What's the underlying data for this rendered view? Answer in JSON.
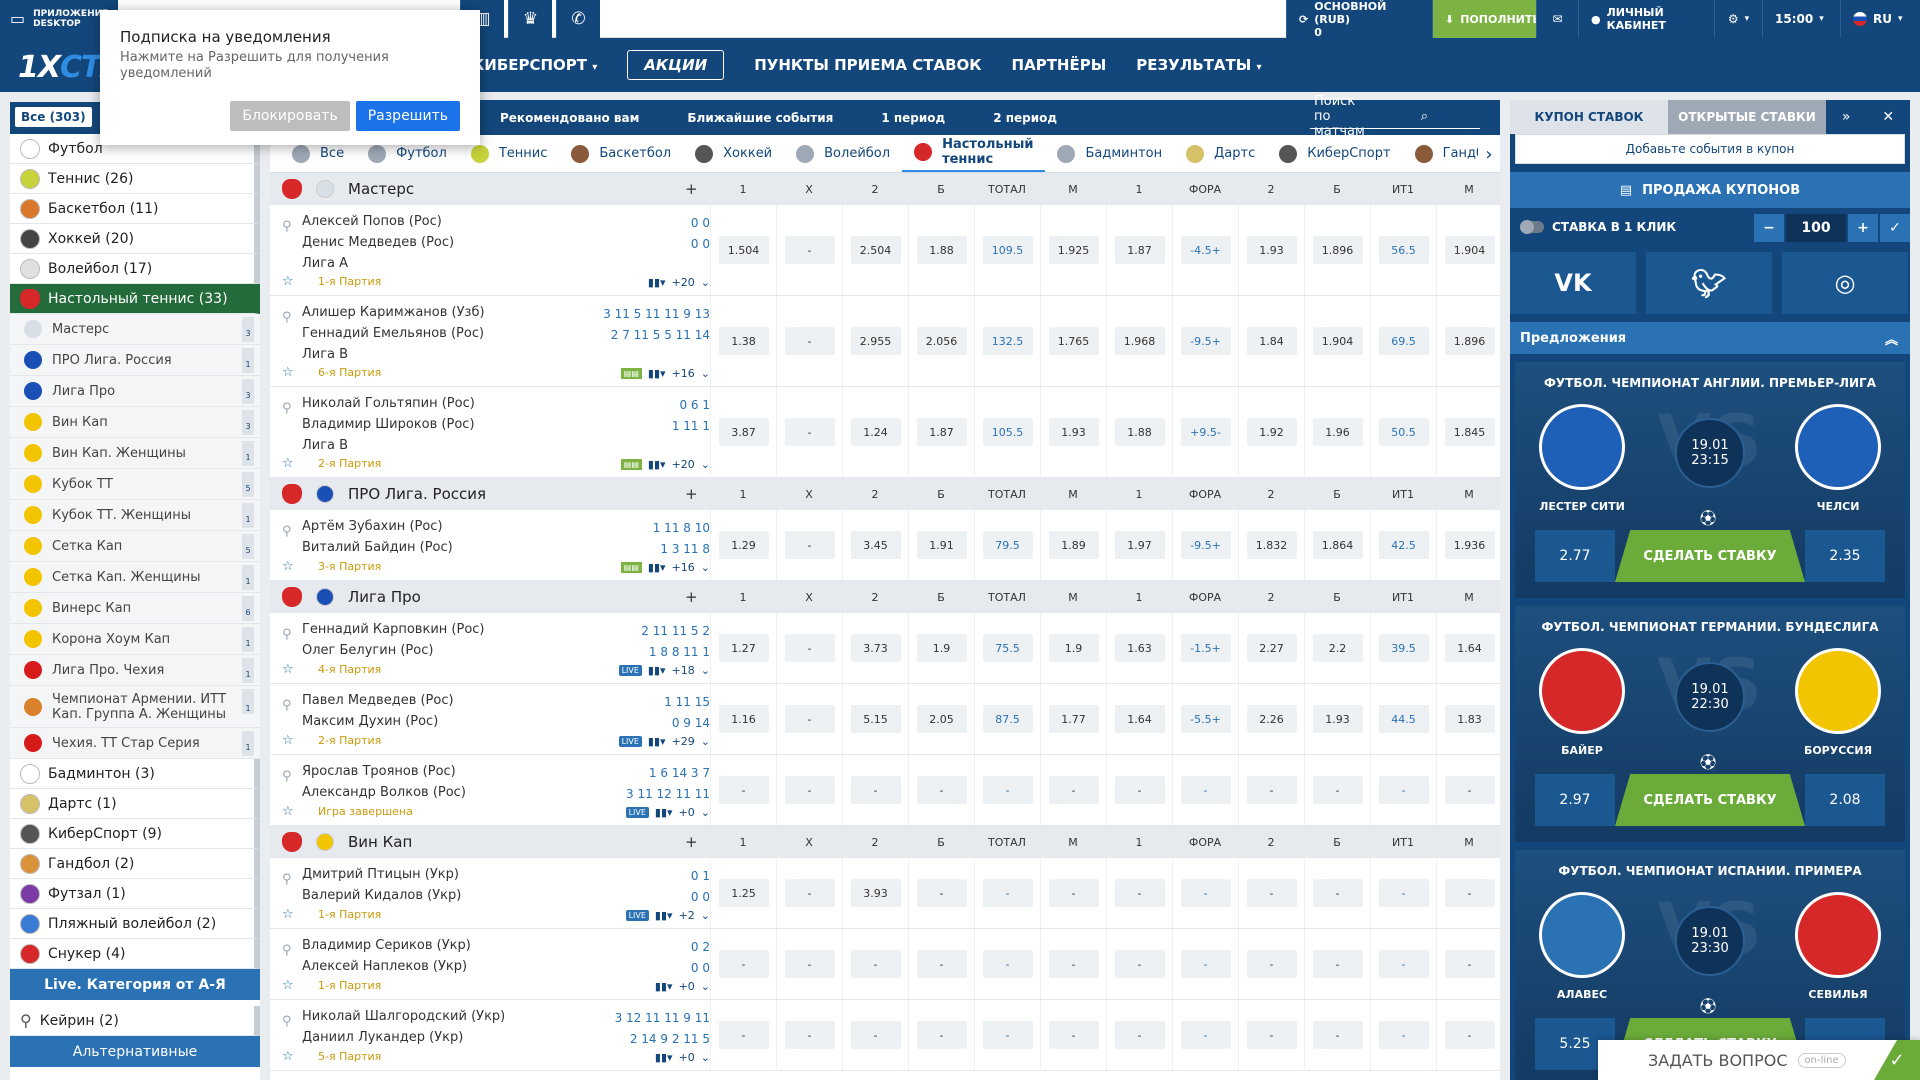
{
  "topbar": {
    "app_label": "ПРИЛОЖЕНИЕ DESKTOP",
    "balance_title": "ОСНОВНОЙ (RUB)",
    "balance_value": "0",
    "deposit": "ПОПОЛНИТЬ",
    "cabinet": "ЛИЧНЫЙ КАБИНЕТ",
    "time": "15:00",
    "lang": "RU"
  },
  "logo": {
    "a": "1X",
    "b": "СТАВКА"
  },
  "nav": {
    "items": [
      "КИБЕРСПОРТ",
      "АКЦИИ",
      "ПУНКТЫ ПРИЕМА СТАВОК",
      "ПАРТНЁРЫ",
      "РЕЗУЛЬТАТЫ"
    ]
  },
  "notification": {
    "title": "Подписка на уведомления",
    "text": "Нажмите на Разрешить для получения уведомлений",
    "block": "Блокировать",
    "allow": "Разрешить"
  },
  "sidebar": {
    "all": "Все (303)",
    "sports_top": [
      {
        "label": "Футбол",
        "color": "#ffffff"
      },
      {
        "label": "Теннис (26)",
        "color": "#c8d23a"
      },
      {
        "label": "Баскетбол (11)",
        "color": "#d9772b"
      },
      {
        "label": "Хоккей (20)",
        "color": "#444444"
      },
      {
        "label": "Волейбол (17)",
        "color": "#e0e0e0"
      }
    ],
    "active_sport": "Настольный теннис (33)",
    "champs": [
      {
        "label": "Мастерс",
        "count": "3",
        "flag": "#d9dfe6"
      },
      {
        "label": "ПРО Лига. Россия",
        "count": "1",
        "flag": "#1a4fb5"
      },
      {
        "label": "Лига Про",
        "count": "3",
        "flag": "#1a4fb5"
      },
      {
        "label": "Вин Кап",
        "count": "3",
        "flag": "#f2c500"
      },
      {
        "label": "Вин Кап. Женщины",
        "count": "1",
        "flag": "#f2c500"
      },
      {
        "label": "Кубок ТТ",
        "count": "5",
        "flag": "#f2c500"
      },
      {
        "label": "Кубок ТТ. Женщины",
        "count": "1",
        "flag": "#f2c500"
      },
      {
        "label": "Сетка Кап",
        "count": "5",
        "flag": "#f2c500"
      },
      {
        "label": "Сетка Кап. Женщины",
        "count": "1",
        "flag": "#f2c500"
      },
      {
        "label": "Винерс Кап",
        "count": "6",
        "flag": "#f2c500"
      },
      {
        "label": "Корона Хоум Кап",
        "count": "1",
        "flag": "#f2c500"
      },
      {
        "label": "Лига Про. Чехия",
        "count": "1",
        "flag": "#d71a1a"
      }
    ],
    "champ_two": {
      "line1": "Чемпионат Армении. ИТТ",
      "line2": "Кап. Группа А. Женщины",
      "count": "1",
      "flag": "#d9822b"
    },
    "champ_last": {
      "label": "Чехия. ТТ Стар Серия",
      "count": "1",
      "flag": "#d71a1a"
    },
    "sports_bottom": [
      {
        "label": "Бадминтон (3)",
        "color": "#ffffff"
      },
      {
        "label": "Дартс (1)",
        "color": "#d6c068"
      },
      {
        "label": "КиберСпорт (9)",
        "color": "#555555"
      },
      {
        "label": "Гандбол (2)",
        "color": "#d9913a"
      },
      {
        "label": "Футзал (1)",
        "color": "#7b3aa6"
      },
      {
        "label": "Пляжный волейбол (2)",
        "color": "#3a7bd6"
      },
      {
        "label": "Снукер (4)",
        "color": "#d62828"
      }
    ],
    "live_cat": "Live. Категория от А-Я",
    "keirin": "Кейрин (2)",
    "alt": "Альтернативные"
  },
  "main": {
    "subtabs": [
      "Рекомендовано вам",
      "Ближайшие события",
      "1 период",
      "2 период"
    ],
    "search": "Поиск по матчам",
    "sporttabs": [
      {
        "label": "Все",
        "color": "#9ea9b5"
      },
      {
        "label": "Футбол",
        "color": "#9ea9b5"
      },
      {
        "label": "Теннис",
        "color": "#c8d23a"
      },
      {
        "label": "Баскетбол",
        "color": "#8a5a3a"
      },
      {
        "label": "Хоккей",
        "color": "#555555"
      },
      {
        "label": "Волейбол",
        "color": "#9ea9b5"
      },
      {
        "label": "Настольный теннис",
        "color": "#d62828"
      },
      {
        "label": "Бадминтон",
        "color": "#9ea9b5"
      },
      {
        "label": "Дартс",
        "color": "#d6c068"
      },
      {
        "label": "КиберСпорт",
        "color": "#555555"
      },
      {
        "label": "Гандбол",
        "color": "#8a5a3a"
      }
    ],
    "headers": [
      "1",
      "X",
      "2",
      "Б",
      "ТОТАЛ",
      "М",
      "1",
      "ФОРА",
      "2",
      "Б",
      "ИТ1",
      "М"
    ],
    "groups": [
      {
        "name": "Мастерс",
        "flag": "#d9dfe6",
        "matches": [
          {
            "p1": "Алексей Попов (Рос)",
            "p2": "Денис Медведев (Рос)",
            "league": "Лига А",
            "s1": "0   0",
            "s2": "0   0",
            "period": "1-я Партия",
            "more": "+20",
            "badge": "",
            "tall": true,
            "odds": [
              "1.504",
              "-",
              "2.504",
              "1.88",
              "109.5",
              "1.925",
              "1.87",
              "-4.5+",
              "1.93",
              "1.896",
              "56.5",
              "1.904"
            ]
          },
          {
            "p1": "Алишер Каримжанов (Узб)",
            "p2": "Геннадий Емельянов (Рос)",
            "league": "Лига В",
            "s1": "3  11  5  11  11  9  13",
            "s2": "2  7  11  5  5  11  14",
            "period": "6-я Партия",
            "more": "+16",
            "badge": "stat",
            "tall": true,
            "odds": [
              "1.38",
              "-",
              "2.955",
              "2.056",
              "132.5",
              "1.765",
              "1.968",
              "-9.5+",
              "1.84",
              "1.904",
              "69.5",
              "1.896"
            ]
          },
          {
            "p1": "Николай Гольтяпин (Рос)",
            "p2": "Владимир Широков (Рос)",
            "league": "Лига В",
            "s1": "0   6   1",
            "s2": "1  11   1",
            "period": "2-я Партия",
            "more": "+20",
            "badge": "stat",
            "tall": true,
            "odds": [
              "3.87",
              "-",
              "1.24",
              "1.87",
              "105.5",
              "1.93",
              "1.88",
              "+9.5-",
              "1.92",
              "1.96",
              "50.5",
              "1.845"
            ]
          }
        ]
      },
      {
        "name": "ПРО Лига. Россия",
        "flag": "#1a4fb5",
        "matches": [
          {
            "p1": "Артём Зубахин (Рос)",
            "p2": "Виталий Байдин (Рос)",
            "league": "",
            "s1": "1  11  8  10",
            "s2": "1   3  11  8",
            "period": "3-я Партия",
            "more": "+16",
            "badge": "stat",
            "tall": false,
            "odds": [
              "1.29",
              "-",
              "3.45",
              "1.91",
              "79.5",
              "1.89",
              "1.97",
              "-9.5+",
              "1.832",
              "1.864",
              "42.5",
              "1.936"
            ]
          }
        ]
      },
      {
        "name": "Лига Про",
        "flag": "#1a4fb5",
        "matches": [
          {
            "p1": "Геннадий Карповкин (Рос)",
            "p2": "Олег Белугин (Рос)",
            "league": "",
            "s1": "2  11  11  5  2",
            "s2": "1   8   8  11  1",
            "period": "4-я Партия",
            "more": "+18",
            "badge": "live",
            "tall": false,
            "odds": [
              "1.27",
              "-",
              "3.73",
              "1.9",
              "75.5",
              "1.9",
              "1.63",
              "-1.5+",
              "2.27",
              "2.2",
              "39.5",
              "1.64"
            ]
          },
          {
            "p1": "Павел Медведев (Рос)",
            "p2": "Максим Духин (Рос)",
            "league": "",
            "s1": "1  11  15",
            "s2": "0   9  14",
            "period": "2-я Партия",
            "more": "+29",
            "badge": "live",
            "tall": false,
            "odds": [
              "1.16",
              "-",
              "5.15",
              "2.05",
              "87.5",
              "1.77",
              "1.64",
              "-5.5+",
              "2.26",
              "1.93",
              "44.5",
              "1.83"
            ]
          },
          {
            "p1": "Ярослав Троянов (Рос)",
            "p2": "Александр Волков (Рос)",
            "league": "",
            "s1": "1  6  14  3  7",
            "s2": "3  11  12  11  11",
            "period": "Игра завершена",
            "more": "+0",
            "badge": "live",
            "tall": false,
            "odds": [
              "-",
              "-",
              "-",
              "-",
              "-",
              "-",
              "-",
              "-",
              "-",
              "-",
              "-",
              "-"
            ]
          }
        ]
      },
      {
        "name": "Вин Кап",
        "flag": "#f2c500",
        "matches": [
          {
            "p1": "Дмитрий Птицын (Укр)",
            "p2": "Валерий Кидалов (Укр)",
            "league": "",
            "s1": "0   1",
            "s2": "0   0",
            "period": "1-я Партия",
            "more": "+2",
            "badge": "live",
            "tall": false,
            "odds": [
              "1.25",
              "-",
              "3.93",
              "-",
              "-",
              "-",
              "-",
              "-",
              "-",
              "-",
              "-",
              "-"
            ]
          },
          {
            "p1": "Владимир Сериков (Укр)",
            "p2": "Алексей Наплеков (Укр)",
            "league": "",
            "s1": "0   2",
            "s2": "0   0",
            "period": "1-я Партия",
            "more": "+0",
            "badge": "",
            "tall": false,
            "odds": [
              "-",
              "-",
              "-",
              "-",
              "-",
              "-",
              "-",
              "-",
              "-",
              "-",
              "-",
              "-"
            ]
          },
          {
            "p1": "Николай Шалгородский (Укр)",
            "p2": "Даниил Лукандер (Укр)",
            "league": "",
            "s1": "3  12  11  11  9  11",
            "s2": "2  14  9  2  11  5",
            "period": "5-я Партия",
            "more": "+0",
            "badge": "",
            "tall": false,
            "odds": [
              "-",
              "-",
              "-",
              "-",
              "-",
              "-",
              "-",
              "-",
              "-",
              "-",
              "-",
              "-"
            ]
          }
        ]
      }
    ]
  },
  "coupon": {
    "tab1": "КУПОН СТАВОК",
    "tab2": "ОТКРЫТЫЕ СТАВКИ",
    "msg": "Добавьте события в купон",
    "sale": "ПРОДАЖА КУПОНОВ",
    "oneclick": "СТАВКА В 1 КЛИК",
    "stake": "100",
    "minus": "−",
    "plus": "+",
    "check": "✓",
    "expand": "»"
  },
  "social": {
    "vk": "VK",
    "tw": "✔",
    "ig": "◎"
  },
  "offers": {
    "title": "Предложения",
    "cards": [
      {
        "title": "ФУТБОЛ. ЧЕМПИОНАТ АНГЛИИ. ПРЕМЬЕР-ЛИГА",
        "t1": "ЛЕСТЕР СИТИ",
        "t2": "ЧЕЛСИ",
        "date": "19.01",
        "time": "23:15",
        "o1": "2.77",
        "o2": "2.35",
        "c1": "#1e5fb8",
        "c2": "#1e5fb8"
      },
      {
        "title": "ФУТБОЛ. ЧЕМПИОНАТ ГЕРМАНИИ. БУНДЕСЛИГА",
        "t1": "БАЙЕР",
        "t2": "БОРУССИЯ",
        "date": "19.01",
        "time": "22:30",
        "o1": "2.97",
        "o2": "2.08",
        "c1": "#d62828",
        "c2": "#f2c500"
      },
      {
        "title": "ФУТБОЛ. ЧЕМПИОНАТ ИСПАНИИ. ПРИМЕРА",
        "t1": "АЛАВЕС",
        "t2": "СЕВИЛЬЯ",
        "date": "19.01",
        "time": "23:30",
        "o1": "5.25",
        "o2": "",
        "c1": "#2a72b3",
        "c2": "#d62828"
      }
    ],
    "make_bet": "СДЕЛАТЬ СТАВКУ"
  },
  "ask": {
    "label": "ЗАДАТЬ ВОПРОС",
    "status": "on-line"
  }
}
